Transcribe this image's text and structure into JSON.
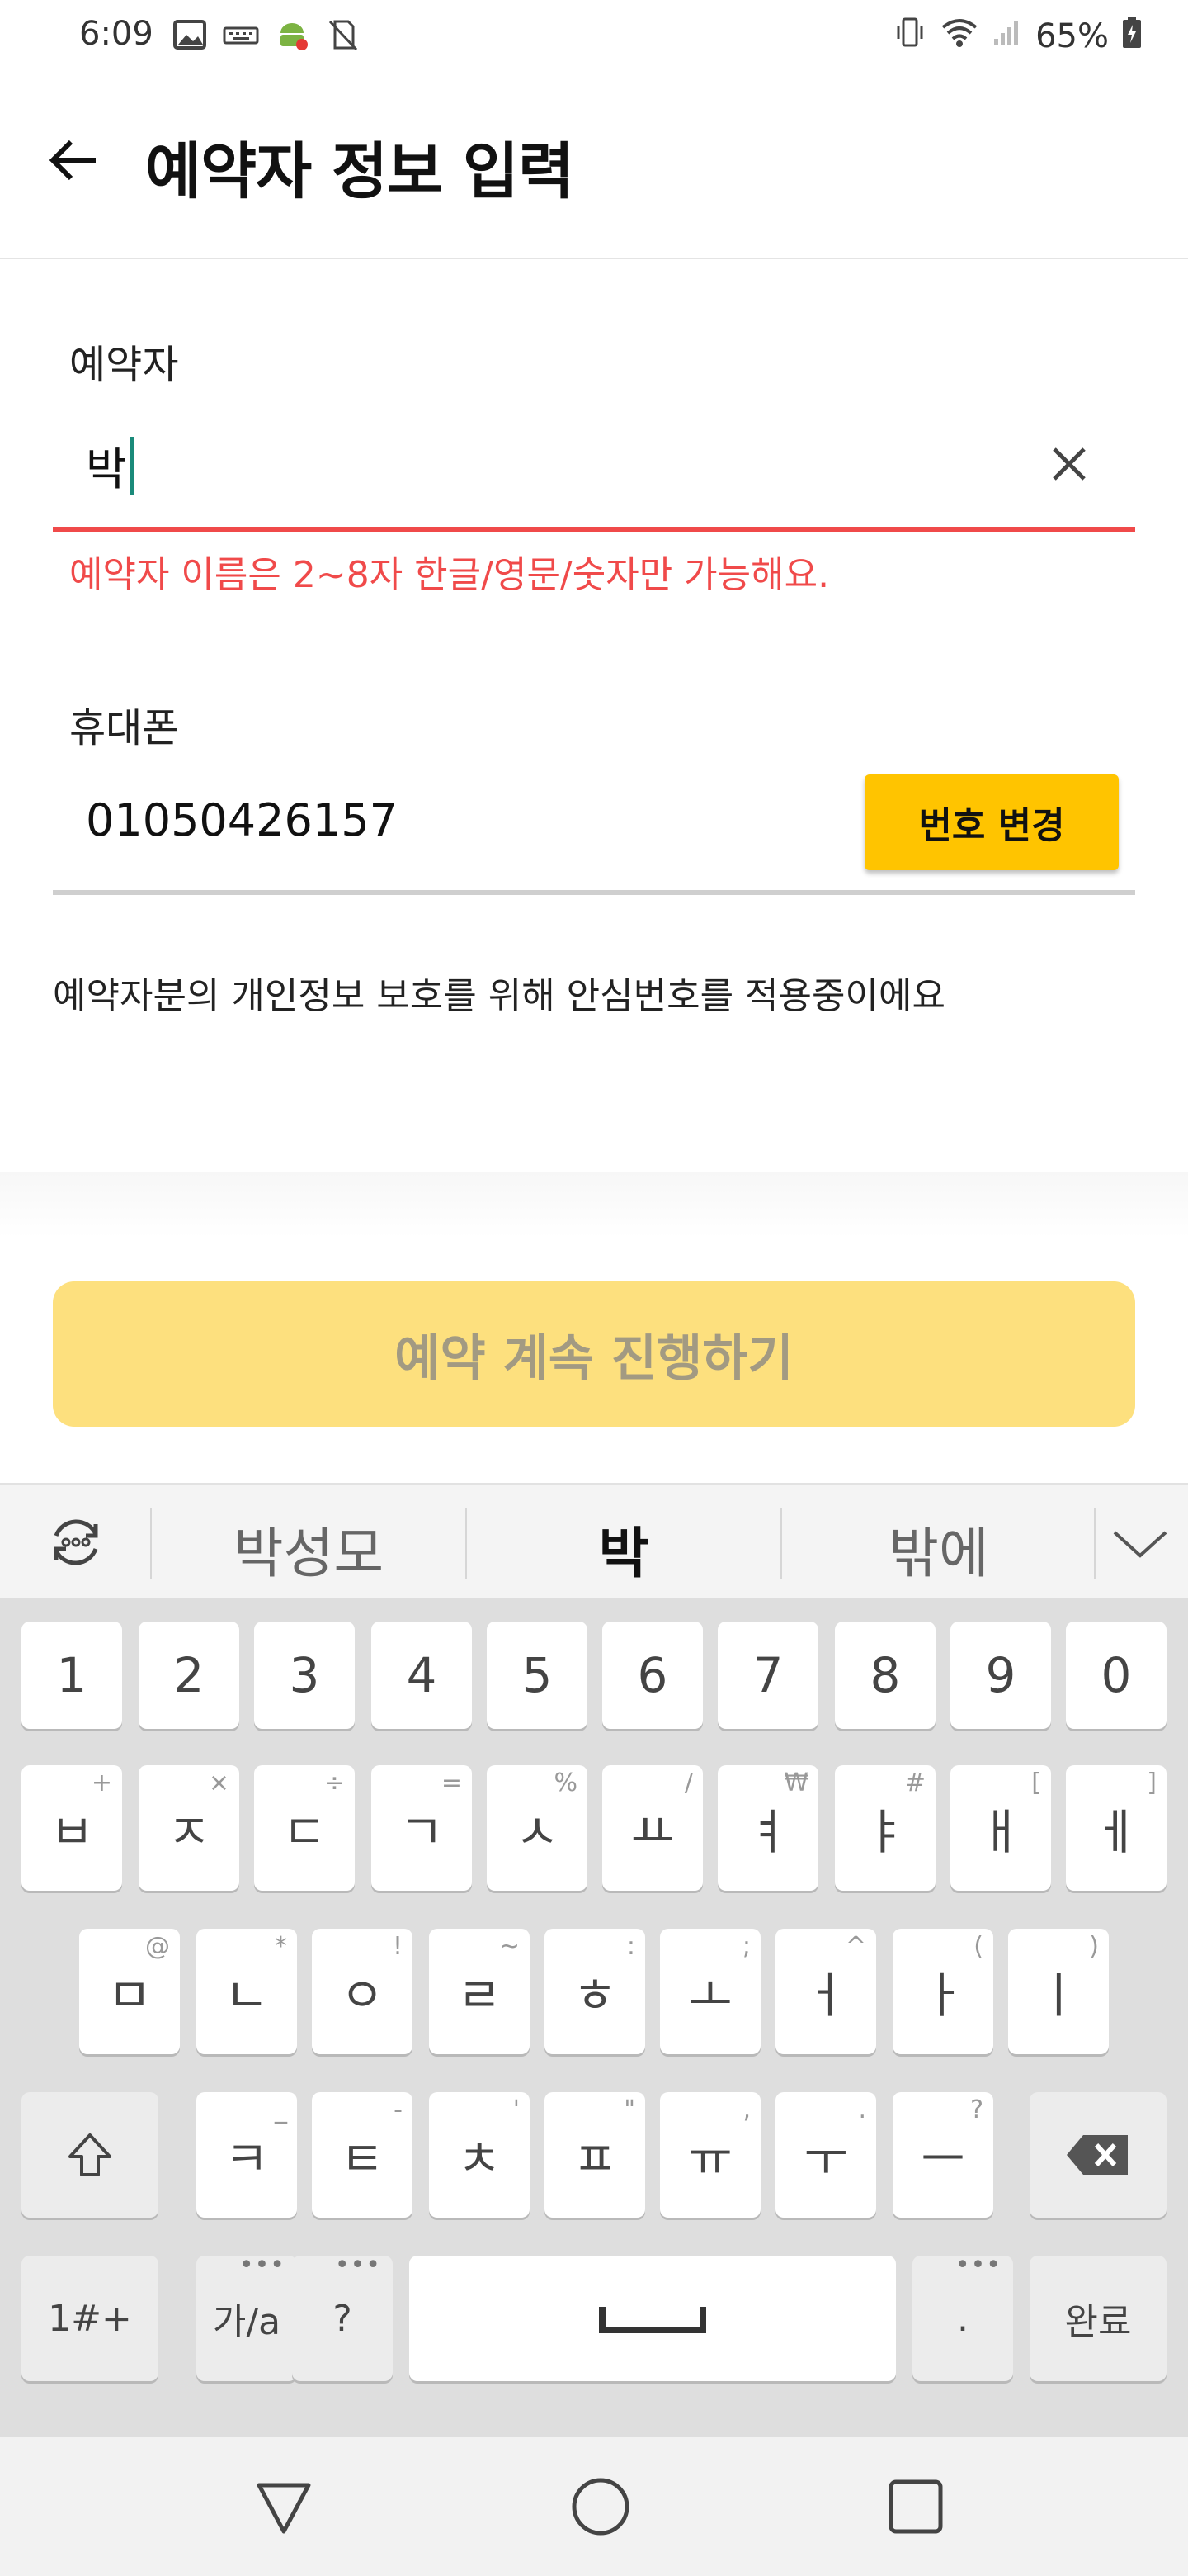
{
  "status_bar": {
    "time": "6:09",
    "battery": "65%",
    "icons_left": [
      "image-icon",
      "keyboard-icon",
      "android-debug-icon",
      "no-sim-icon"
    ],
    "icons_right": [
      "vibrate-icon",
      "wifi-icon",
      "signal-icon",
      "battery-charging-icon"
    ]
  },
  "header": {
    "title": "예약자 정보 입력",
    "back_icon": "arrow-left-icon"
  },
  "form": {
    "name_label": "예약자",
    "name_value": "박",
    "name_error": "예약자 이름은 2~8자 한글/영문/숫자만 가능해요.",
    "phone_label": "휴대폰",
    "phone_value": "01050426157",
    "change_number_label": "번호 변경",
    "privacy_note": "예약자분의 개인정보 보호를 위해 안심번호를 적용중이에요"
  },
  "continue_button": "예약 계속 진행하기",
  "colors": {
    "error": "#f04a4a",
    "accent_yellow": "#ffc400",
    "disabled_yellow": "#fde07e",
    "caret": "#1a8a7a"
  },
  "keyboard": {
    "suggestions": [
      "박성모",
      "박",
      "밖에"
    ],
    "number_row": [
      "1",
      "2",
      "3",
      "4",
      "5",
      "6",
      "7",
      "8",
      "9",
      "0"
    ],
    "row1": [
      {
        "k": "ㅂ",
        "s": "+"
      },
      {
        "k": "ㅈ",
        "s": "×"
      },
      {
        "k": "ㄷ",
        "s": "÷"
      },
      {
        "k": "ㄱ",
        "s": "="
      },
      {
        "k": "ㅅ",
        "s": "%"
      },
      {
        "k": "ㅛ",
        "s": "/"
      },
      {
        "k": "ㅕ",
        "s": "₩"
      },
      {
        "k": "ㅑ",
        "s": "#"
      },
      {
        "k": "ㅐ",
        "s": "["
      },
      {
        "k": "ㅔ",
        "s": "]"
      }
    ],
    "row2": [
      {
        "k": "ㅁ",
        "s": "@"
      },
      {
        "k": "ㄴ",
        "s": "*"
      },
      {
        "k": "ㅇ",
        "s": "!"
      },
      {
        "k": "ㄹ",
        "s": "~"
      },
      {
        "k": "ㅎ",
        "s": ":"
      },
      {
        "k": "ㅗ",
        "s": ";"
      },
      {
        "k": "ㅓ",
        "s": "^"
      },
      {
        "k": "ㅏ",
        "s": "("
      },
      {
        "k": "ㅣ",
        "s": ")"
      }
    ],
    "row3": [
      {
        "k": "ㅋ",
        "s": "_"
      },
      {
        "k": "ㅌ",
        "s": "-"
      },
      {
        "k": "ㅊ",
        "s": "'"
      },
      {
        "k": "ㅍ",
        "s": "\""
      },
      {
        "k": "ㅠ",
        "s": ","
      },
      {
        "k": "ㅜ",
        "s": "."
      },
      {
        "k": "ㅡ",
        "s": "?"
      }
    ],
    "symbols_key": "1#+",
    "lang_key": "가/a",
    "question_key": "?",
    "period_key": ".",
    "done_key": "완료"
  }
}
